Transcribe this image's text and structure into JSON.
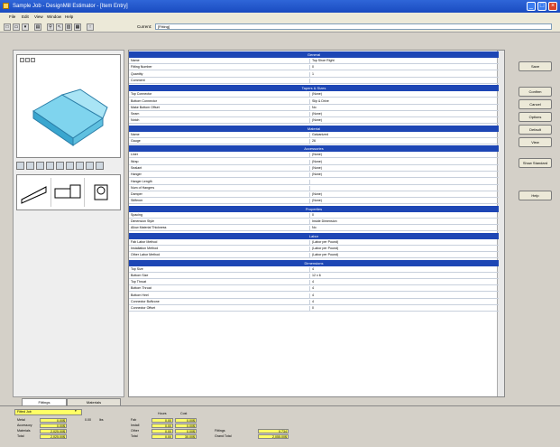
{
  "window": {
    "title": "Sample Job - DesignMill Estimator - [Item Entry]"
  },
  "menu": [
    "File",
    "Edit",
    "View",
    "Window",
    "Help"
  ],
  "toolbar": {
    "current_label": "Current:",
    "current_value": "[Fitting]"
  },
  "colors": {
    "title_bar": "#1a4bc0",
    "section_header": "#1d46b5",
    "highlight": "#ffff66"
  },
  "right_buttons": [
    "Save",
    "Confirm",
    "Cancel",
    "Options",
    "Default",
    "View",
    "Show Standard",
    "Help"
  ],
  "rows": [
    {
      "header": "General"
    },
    {
      "k": "Name",
      "v": "Top Shoe Right"
    },
    {
      "k": "Fitting Number",
      "v": "0"
    },
    {
      "k": "Quantity",
      "v": "1"
    },
    {
      "k": "Comment",
      "v": ""
    },
    {
      "header": "Tapers & Sizes"
    },
    {
      "k": "Top Connector",
      "v": "(None)"
    },
    {
      "k": "Bottom Connector",
      "v": "Slip & Drive"
    },
    {
      "k": "Make Bottom Offset",
      "v": "No"
    },
    {
      "k": "Seam",
      "v": "(None)"
    },
    {
      "k": "Notch",
      "v": "(None)"
    },
    {
      "header": "Material"
    },
    {
      "k": "Name",
      "v": "Galvanized"
    },
    {
      "k": "Gauge",
      "v": "26"
    },
    {
      "header": "Accessories"
    },
    {
      "k": "Liner",
      "v": "(None)"
    },
    {
      "k": "Wrap",
      "v": "(None)"
    },
    {
      "k": "Sealant",
      "v": "(None)"
    },
    {
      "k": "Hanger",
      "v": "(None)"
    },
    {
      "k": "Hanger Length",
      "v": ""
    },
    {
      "k": "Num of Hangers",
      "v": ""
    },
    {
      "k": "Damper",
      "v": "(None)"
    },
    {
      "k": "Stiffener",
      "v": "(None)"
    },
    {
      "header": "Properties"
    },
    {
      "k": "Spacing",
      "v": "0"
    },
    {
      "k": "Dimension Style",
      "v": "Inside Dimension"
    },
    {
      "k": "Allow Material Thickness",
      "v": "No"
    },
    {
      "header": "Labor"
    },
    {
      "k": "Fab Labor Method",
      "v": "(Labor per Pound)"
    },
    {
      "k": "Installation Method",
      "v": "(Labor per Pound)"
    },
    {
      "k": "Other Labor Method",
      "v": "(Labor per Pound)"
    },
    {
      "header": "Dimensions"
    },
    {
      "k": "Top Size",
      "v": "4"
    },
    {
      "k": "Bottom Size",
      "v": "12 x 6"
    },
    {
      "k": "Top Throat",
      "v": "4"
    },
    {
      "k": "Bottom Throat",
      "v": "4"
    },
    {
      "k": "Bottom Heel",
      "v": "4"
    },
    {
      "k": "Connector Buffzone",
      "v": "4"
    },
    {
      "k": "Connector Offset",
      "v": "0"
    }
  ],
  "tabs": [
    "Fittings",
    "Materials"
  ],
  "totals": {
    "filter": "Fitted Job",
    "left_labels": [
      "Metal",
      "Accessory",
      "Materials",
      "Total"
    ],
    "left_vals": [
      "0.00$",
      "0.00$",
      "2,025.00$",
      "2,025.00$"
    ],
    "extra_val": "0.00",
    "extra_unit": "lbs",
    "mid_labels": [
      "Fab",
      "Install",
      "Other",
      "Total"
    ],
    "col_headers": [
      "Hours",
      "Cost"
    ],
    "hours": [
      "0.00",
      "0.00",
      "0.00",
      "0.00"
    ],
    "cost": [
      "0.00$",
      "0.00$",
      "0.00$",
      "30.00$"
    ],
    "right_labels": [
      "Fittings",
      "Grand Total"
    ],
    "right_vals": [
      "0.734",
      "2,055.00$"
    ]
  }
}
